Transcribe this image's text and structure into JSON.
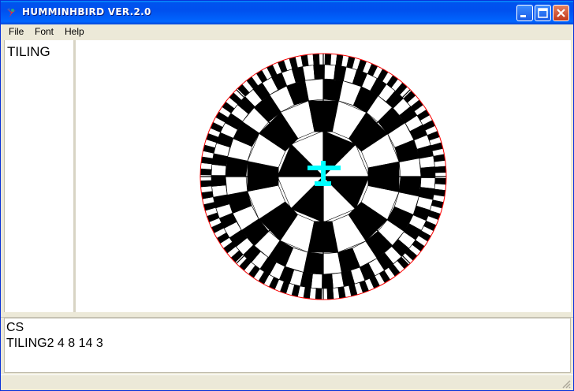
{
  "window": {
    "title": "HUMMINHBIRD VER.2.0"
  },
  "menu": {
    "file": "File",
    "font": "Font",
    "help": "Help"
  },
  "left_panel": {
    "text": "TILING"
  },
  "console": {
    "lines": [
      "CS",
      "TILING2 4 8 14 3"
    ]
  },
  "colors": {
    "disk_border": "#ff0000",
    "cursor": "#00ffff",
    "fill_dark": "#000000",
    "fill_light": "#ffffff"
  },
  "icons": {
    "app": "hummingbird-icon",
    "minimize": "minimize-icon",
    "maximize": "maximize-icon",
    "close": "close-icon"
  }
}
